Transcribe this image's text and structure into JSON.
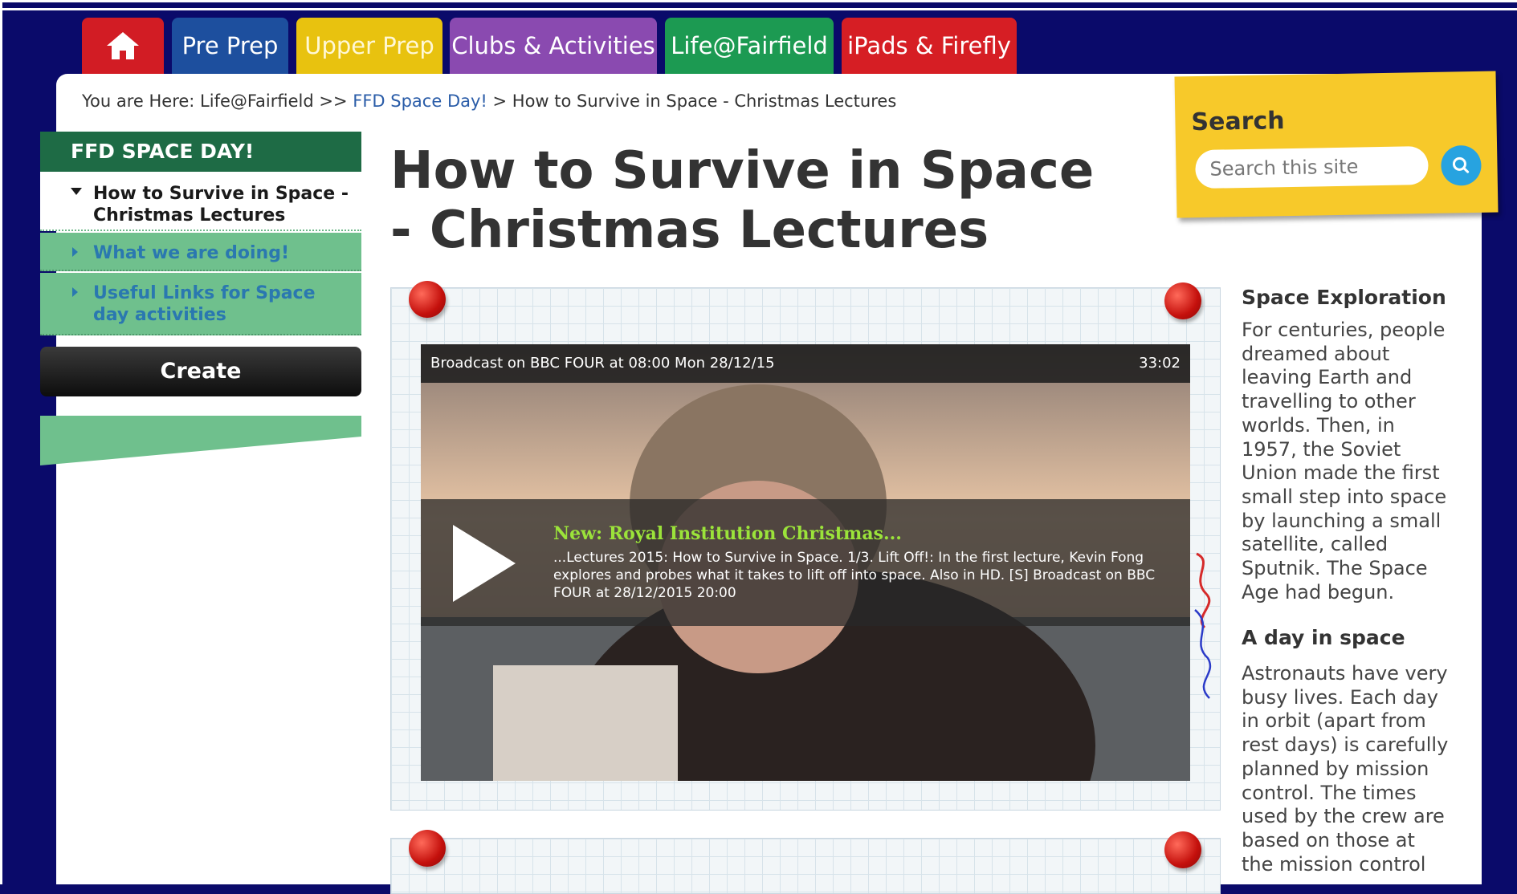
{
  "nav": {
    "home_icon": "home-icon",
    "tabs": [
      {
        "label": "Pre Prep",
        "color": "#1d4f9e"
      },
      {
        "label": "Upper Prep",
        "color": "#e8c20f"
      },
      {
        "label": "Clubs & Activities",
        "color": "#8a4ab0"
      },
      {
        "label": "Life@Fairfield",
        "color": "#1c9a52"
      },
      {
        "label": "iPads & Firefly",
        "color": "#d61e24"
      }
    ]
  },
  "breadcrumb": {
    "prefix": "You are Here: Life@Fairfield >> ",
    "link": "FFD Space Day!",
    "sep": " > ",
    "current": "How to Survive in Space - Christmas Lectures"
  },
  "sidebar": {
    "heading": "FFD SPACE DAY!",
    "items": [
      {
        "label": "How to Survive in Space - Christmas Lectures"
      },
      {
        "label": "What we are doing!"
      },
      {
        "label": "Useful Links for Space day activities"
      }
    ],
    "create_label": "Create"
  },
  "page": {
    "title": "How to Survive in Space - Christmas Lectures"
  },
  "search": {
    "title": "Search",
    "placeholder": "Search this site",
    "icon": "search-icon"
  },
  "video": {
    "broadcast": "Broadcast on BBC FOUR at 08:00 Mon 28/12/15",
    "duration": "33:02",
    "headline": "New: Royal Institution Christmas...",
    "description": "...Lectures 2015: How to Survive in Space. 1/3. Lift Off!: In the first lecture, Kevin Fong explores and probes what it takes to lift off into space. Also in HD. [S] Broadcast on BBC FOUR at 28/12/2015 20:00",
    "play_icon": "play-icon"
  },
  "right_column": {
    "section1": {
      "heading": "Space Exploration",
      "lines": [
        "For centuries, people",
        "dreamed about",
        "leaving Earth and",
        "travelling to other",
        "worlds. Then, in",
        "1957, the Soviet",
        "Union made the first",
        "small step into space",
        "by launching a small",
        "satellite, called",
        "Sputnik. The Space",
        "Age had begun."
      ]
    },
    "section2": {
      "heading": "A day in space",
      "lines": [
        "Astronauts have very",
        "busy lives. Each day",
        "in orbit (apart from",
        "rest days) is carefully",
        "planned by mission",
        "control. The times",
        "used by the crew are",
        "based on those at",
        "the mission control"
      ]
    }
  }
}
